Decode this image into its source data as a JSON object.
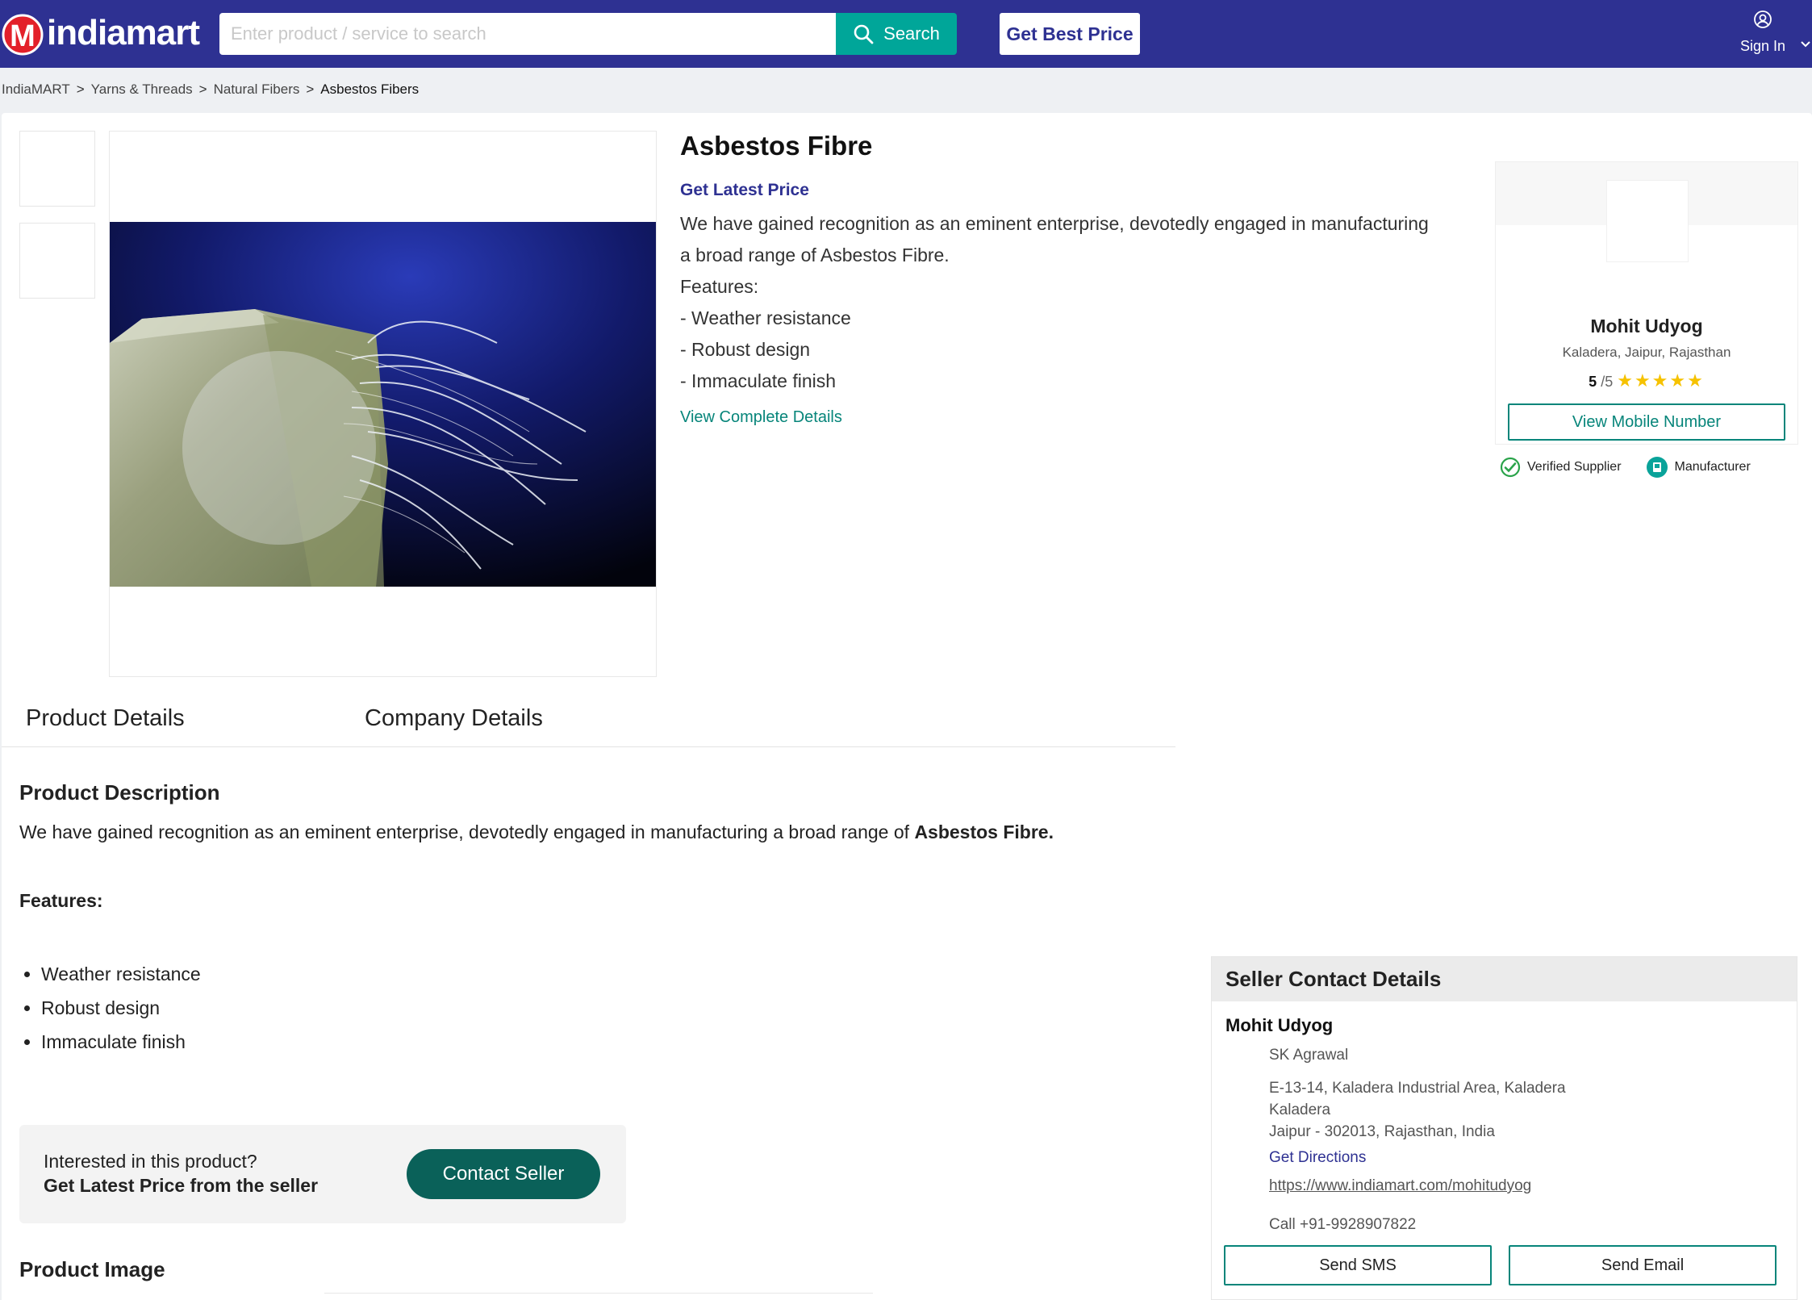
{
  "header": {
    "logo_text": "indiamart",
    "logo_letter": "M",
    "search_placeholder": "Enter product / service to search",
    "search_label": "Search",
    "best_price_label": "Get Best Price",
    "signin_label": "Sign In"
  },
  "breadcrumb": [
    "IndiaMART",
    "Yarns & Threads",
    "Natural Fibers",
    "Asbestos Fibers"
  ],
  "breadcrumb_sep": ">",
  "product": {
    "title": "Asbestos Fibre",
    "latest_price": "Get Latest Price",
    "desc_line1": "We have gained recognition as an eminent enterprise, devotedly engaged in manufacturing",
    "desc_line2": "a broad range of Asbestos Fibre.",
    "features_label": "Features:",
    "features": [
      "- Weather resistance",
      "- Robust design",
      "- Immaculate finish"
    ],
    "view_details": "View Complete Details"
  },
  "seller": {
    "name": "Mohit Udyog",
    "location": "Kaladera, Jaipur, Rajasthan",
    "rating": "5",
    "rating_of": "/5",
    "stars": "★★★★★",
    "mobile_btn": "View Mobile Number",
    "badge_verified": "Verified Supplier",
    "badge_manufacturer": "Manufacturer"
  },
  "tabs": [
    "Product Details",
    "Company Details"
  ],
  "description": {
    "heading": "Product Description",
    "text_plain": "We have gained recognition as an eminent enterprise, devotedly engaged in manufacturing a broad range of ",
    "text_bold": "Asbestos Fibre.",
    "features_heading": "Features:",
    "features": [
      "Weather resistance",
      "Robust design",
      "Immaculate finish"
    ]
  },
  "interest": {
    "question": "Interested in this product?",
    "cta_text": "Get Latest Price from the seller",
    "button": "Contact Seller"
  },
  "product_image_heading": "Product Image",
  "contact": {
    "heading": "Seller Contact Details",
    "company": "Mohit Udyog",
    "person": "SK Agrawal",
    "address_1": "E-13-14, Kaladera Industrial Area, Kaladera",
    "address_2": "Kaladera",
    "address_3": "Jaipur - 302013, Rajasthan, India",
    "directions": "Get Directions",
    "url": "https://www.indiamart.com/mohitudyog",
    "call": "Call +91-9928907822",
    "sms_btn": "Send SMS",
    "email_btn": "Send Email"
  },
  "colors": {
    "header_bg": "#2e3192",
    "search_btn": "#00a699",
    "accent_teal": "#07857a",
    "contact_btn": "#0a6159",
    "star": "#f6c200",
    "logo_red": "#e3202a"
  }
}
